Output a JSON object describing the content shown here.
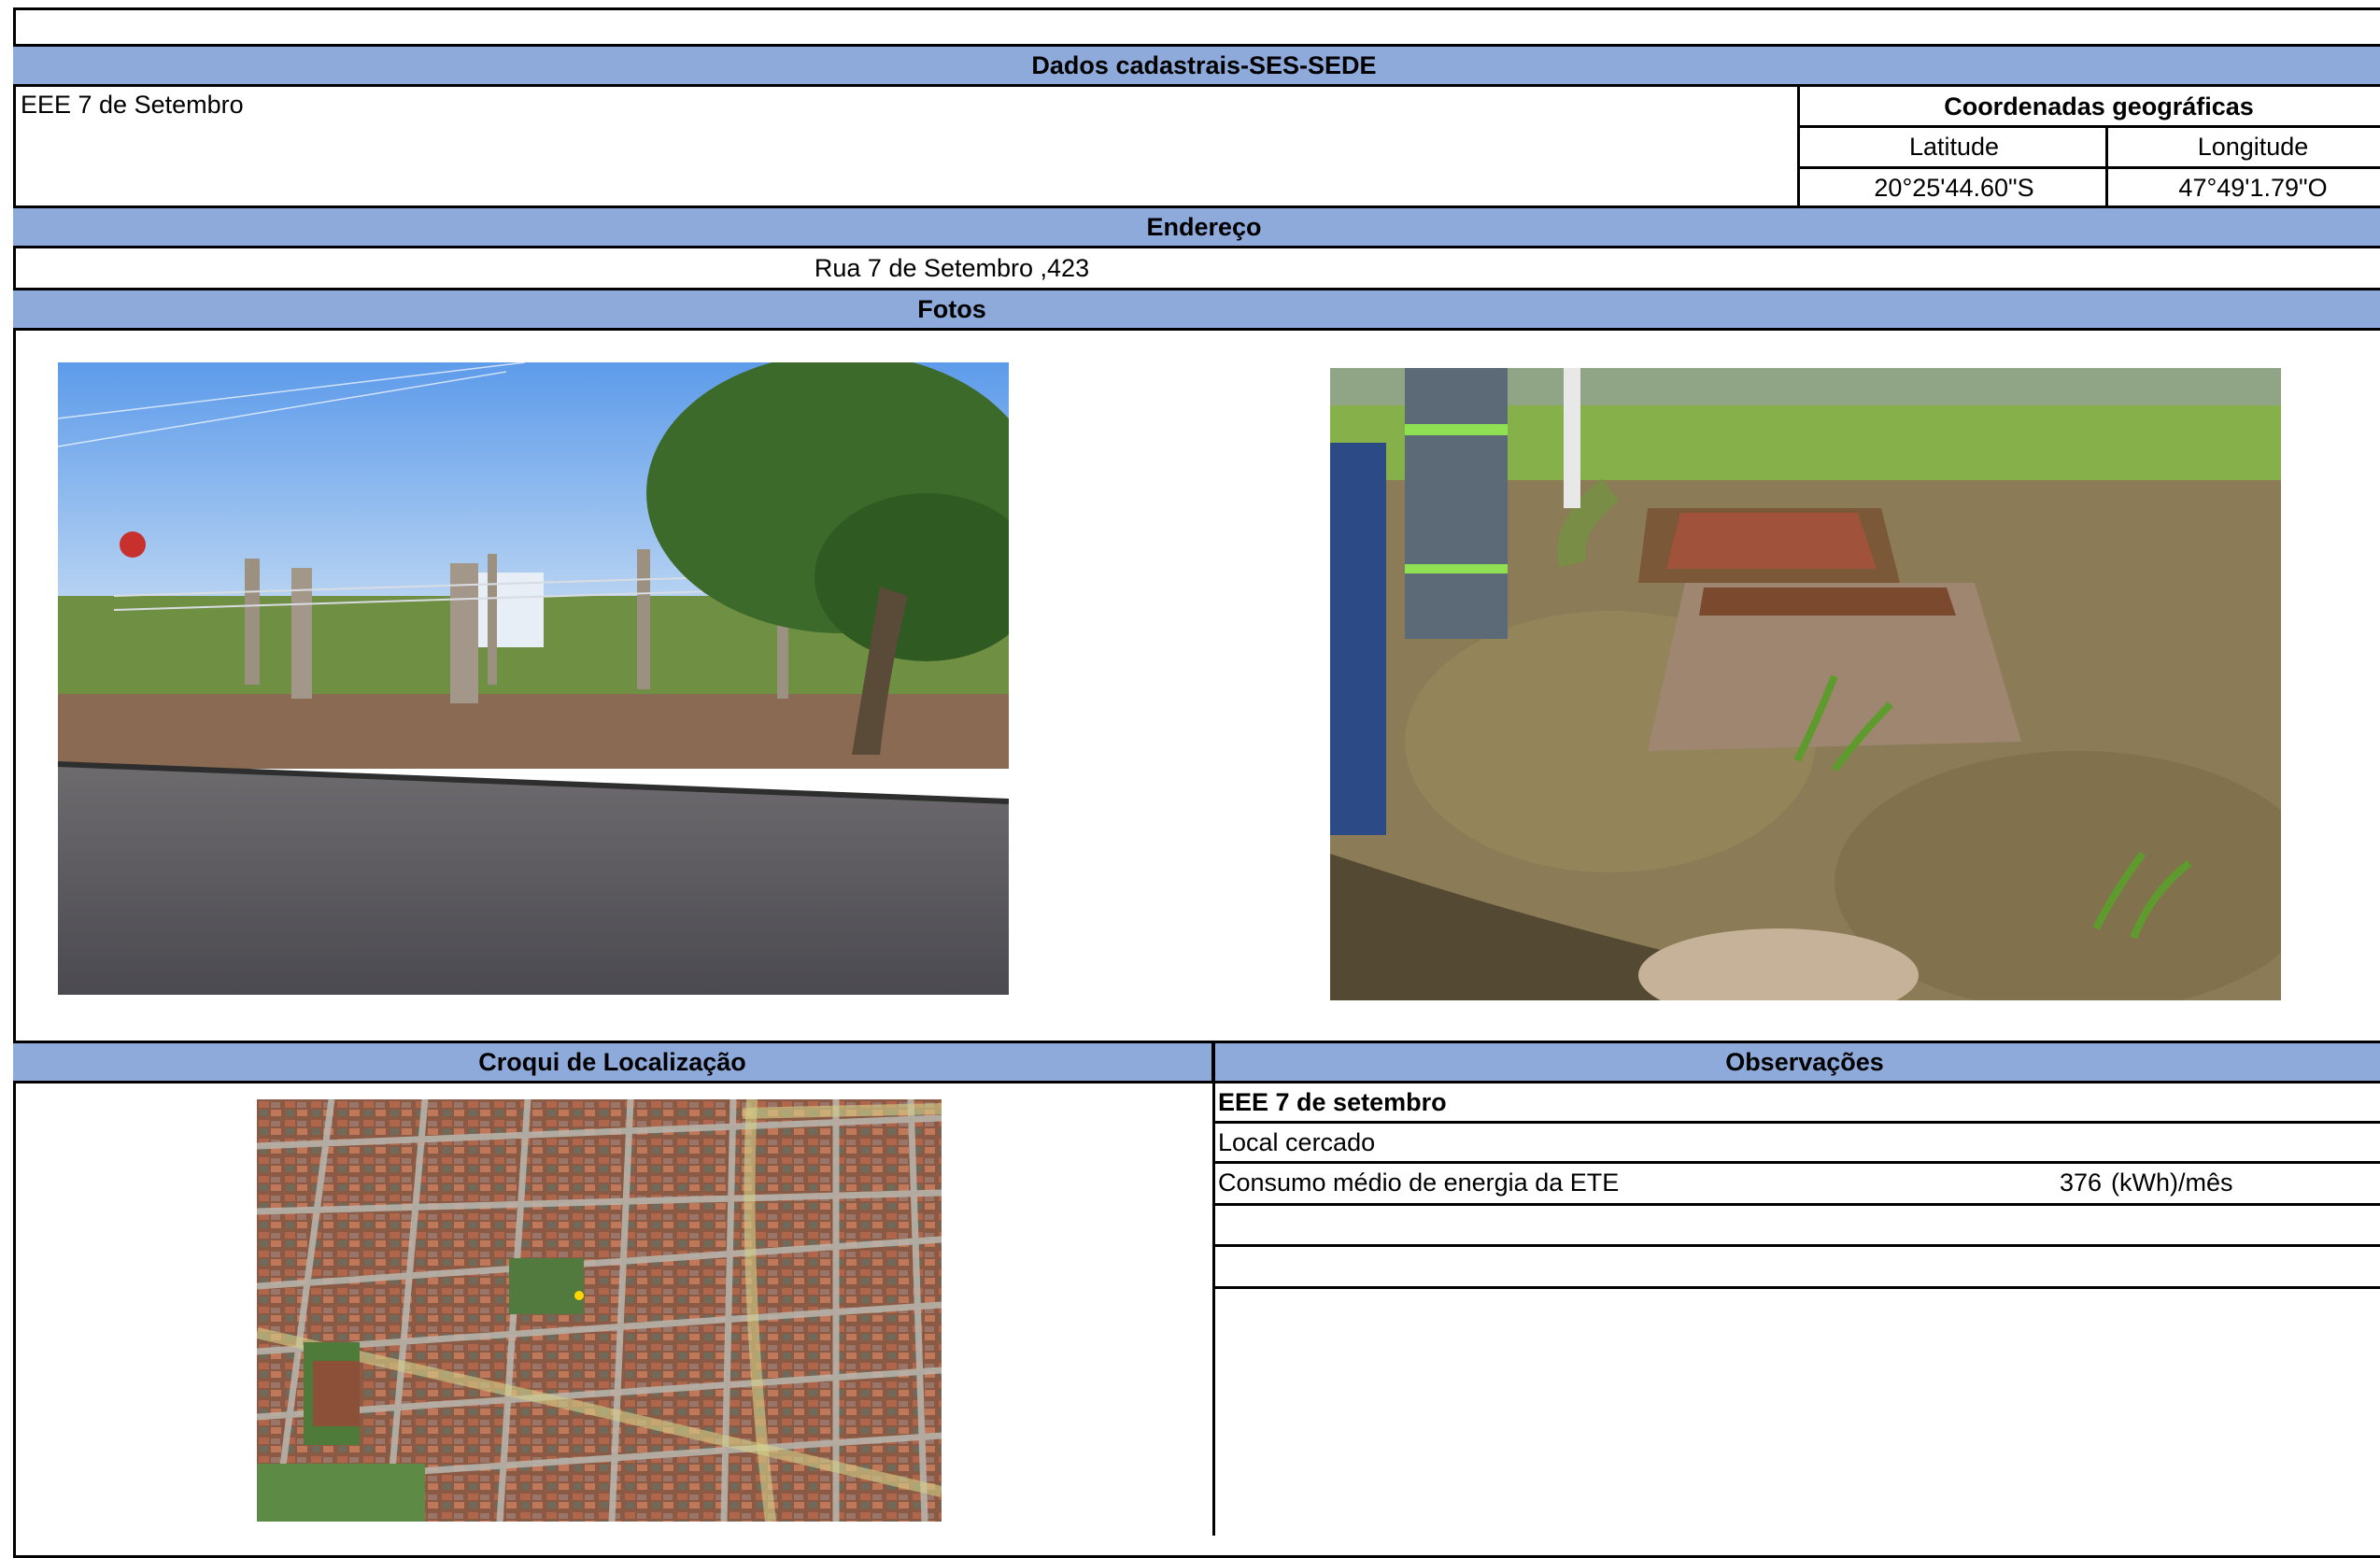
{
  "sheet": {
    "title": "Dados cadastrais-SES-SEDE",
    "site_name": "EEE 7 de Setembro",
    "coords": {
      "header": "Coordenadas geográficas",
      "lat_label": "Latitude",
      "lon_label": "Longitude",
      "lat_value": "20°25'44.60\"S",
      "lon_value": "47°49'1.79\"O"
    },
    "address": {
      "header": "Endereço",
      "value": "Rua 7 de Setembro ,423"
    },
    "photos": {
      "header": "Fotos",
      "photo1_icon": "photo-street-fence",
      "photo2_icon": "photo-station-lids"
    },
    "croqui": {
      "header": "Croqui de Localização",
      "map_icon": "satellite-map"
    },
    "observacoes": {
      "header": "Observações",
      "line1": "EEE 7 de setembro",
      "line2": "Local cercado",
      "line3_label": "Consumo médio de energia da ETE",
      "line3_value": "376",
      "line3_unit": "(kWh)/mês"
    }
  },
  "colors": {
    "header_band": "#8eaadb",
    "border": "#000000"
  }
}
